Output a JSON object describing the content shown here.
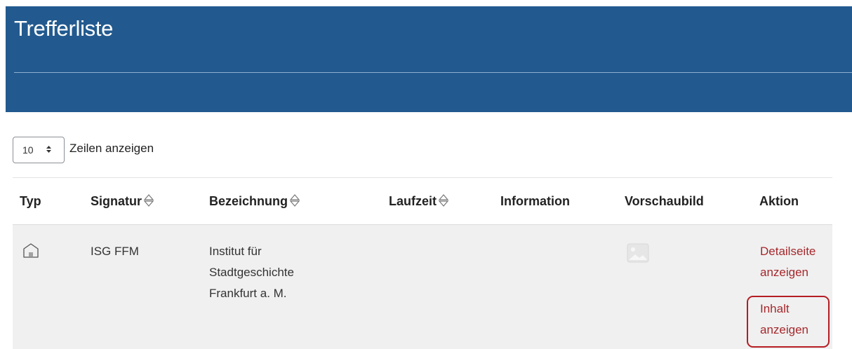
{
  "header": {
    "title": "Trefferliste"
  },
  "table_controls": {
    "page_length_value": "10",
    "page_length_arrows": "◆",
    "page_length_label": "Zeilen anzeigen"
  },
  "table": {
    "columns": [
      {
        "label": "Typ",
        "sortable": false
      },
      {
        "label": "Signatur",
        "sortable": true
      },
      {
        "label": "Bezeichnung",
        "sortable": true
      },
      {
        "label": "Laufzeit",
        "sortable": true
      },
      {
        "label": "Information",
        "sortable": false
      },
      {
        "label": "Vorschaubild",
        "sortable": false
      },
      {
        "label": "Aktion",
        "sortable": false
      }
    ],
    "rows": [
      {
        "type_icon": "archive-building-icon",
        "signatur": "ISG FFM",
        "bezeichnung": "Institut für Stadtgeschichte Frankfurt a. M.",
        "bezeichnung_lines": [
          "Institut für",
          "Stadtgeschichte",
          "Frankfurt a. M."
        ],
        "laufzeit": "",
        "information": "",
        "preview_icon": "image-placeholder-icon",
        "actions": {
          "detail_line1": "Detailseite",
          "detail_line2": "anzeigen",
          "content_line1": "Inhalt",
          "content_line2": "anzeigen"
        }
      }
    ]
  },
  "colors": {
    "header_bg": "#225a8f",
    "link": "#a5282c",
    "highlight": "#b51d24",
    "row_bg": "#f0f0f0"
  }
}
